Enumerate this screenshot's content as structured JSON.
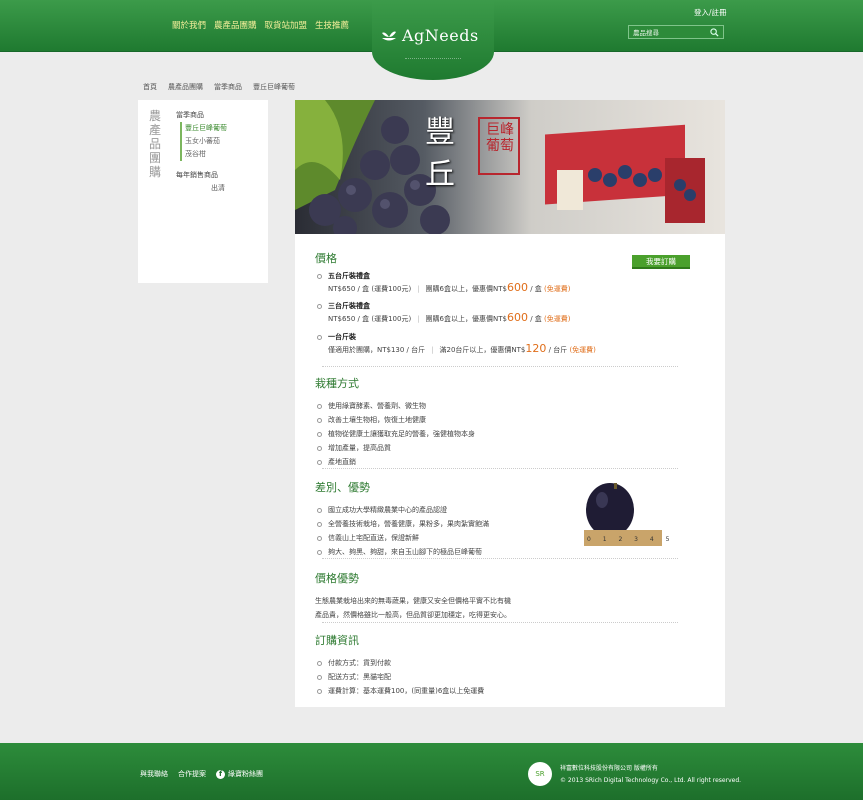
{
  "header": {
    "nav": [
      "關於我們",
      "農產品團購",
      "取貨站加盟",
      "生技推薦"
    ],
    "logo_text": "AgNeeds",
    "login": "登入/註冊",
    "search_placeholder": "農品搜尋"
  },
  "breadcrumb": [
    "首頁",
    "農產品團購",
    "當季商品",
    "豐丘巨峰葡萄"
  ],
  "sidebar": {
    "title": "農產品團購",
    "group1": "當季商品",
    "items": [
      "豐丘巨峰葡萄",
      "玉女小蕃茄",
      "茂谷柑"
    ],
    "group2": "每年銷售商品",
    "ship": "出清"
  },
  "banner": {
    "big_title": "豐丘",
    "stamp": "巨峰葡萄"
  },
  "price": {
    "title": "價格",
    "order_button": "我要訂購",
    "items": [
      {
        "name": "五台斤裝禮盒",
        "base": "NT$650 / 盒 (運費100元)",
        "bulk_pre": "團購6盒以上，優惠價NT$",
        "bulk_price": "600",
        "unit": "/ 盒",
        "free": "(免運費)"
      },
      {
        "name": "三台斤裝禮盒",
        "base": "NT$650 / 盒 (運費100元)",
        "bulk_pre": "團購6盒以上，優惠價NT$",
        "bulk_price": "600",
        "unit": "/ 盒",
        "free": "(免運費)"
      },
      {
        "name": "一台斤裝",
        "base": "僅適用於團購，NT$130 / 台斤",
        "bulk_pre": "滿20台斤以上，優惠價NT$",
        "bulk_price": "120",
        "unit": "/ 台斤",
        "free": "(免運費)"
      }
    ]
  },
  "cultivation": {
    "title": "栽種方式",
    "items": [
      "使用綠寶酵素、營養劑、微生物",
      "改善土壤生物相，恢復土地健康",
      "植物從健康土讓獲取充足的營養，強健植物本身",
      "增加產量，提高品質",
      "產地直銷"
    ]
  },
  "advantage": {
    "title": "差別、優勢",
    "items": [
      "國立成功大學精緻農業中心的產品認證",
      "全營養技術栽培，營養健康，果粉多，果肉紮實飽滿",
      "信義山上宅配直送，保證新鮮",
      "夠大、夠黑、夠甜，來自玉山腳下的極品巨峰葡萄"
    ],
    "ruler": "0 1 2 3 4 5"
  },
  "value": {
    "title": "價格優勢",
    "lines": [
      "生態農業栽培出來的無毒蔬果，健康又安全但價格平實不比有機",
      "產品貴，然價格雖比一般高，但品質卻更加穩定，吃得更安心。"
    ]
  },
  "order_info": {
    "title": "訂購資訊",
    "items": [
      "付款方式：貨到付款",
      "配送方式：黑貓宅配",
      "運費計算：基本運費100，(同重量)6盒以上免運費"
    ]
  },
  "footer": {
    "links": [
      "與我聯絡",
      "合作提案",
      "綠寶粉絲團"
    ],
    "company": "祥富數位科技股份有限公司 版權所有",
    "copyright": "© 2013 SRich Digital Technology Co., Ltd. All right reserved."
  },
  "colors": {
    "brand_green": "#2d8c3b",
    "accent_orange": "#e06e1a",
    "button_green": "#4aa02c"
  }
}
